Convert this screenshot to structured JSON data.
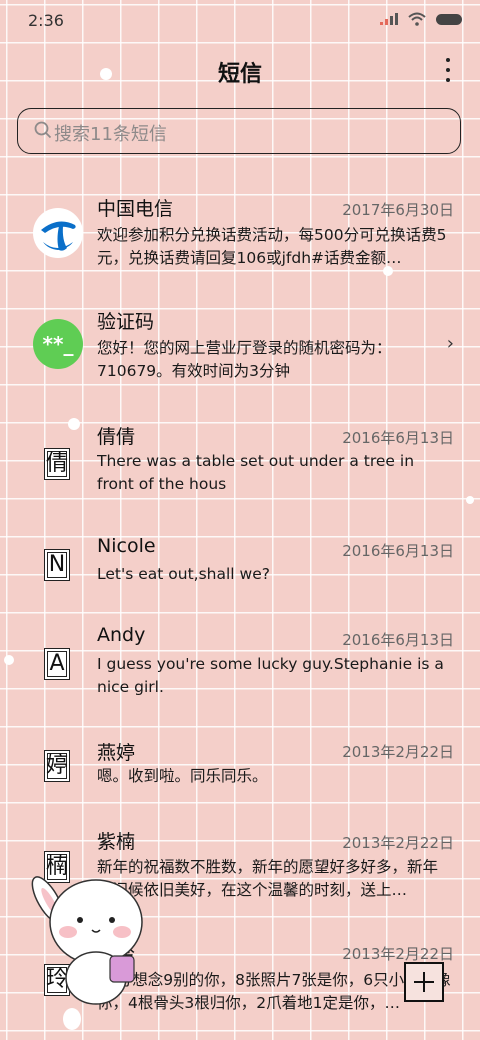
{
  "status_bar": {
    "time": "2:36"
  },
  "header": {
    "title": "短信"
  },
  "search": {
    "placeholder": "搜索11条短信"
  },
  "messages": [
    {
      "name": "中国电信",
      "date": "2017年6月30日",
      "preview": "欢迎参加积分兑换话费活动，每500分可兑换话费5元，兑换话费请回复106或jfdh#话费金额…",
      "avatar": "china-telecom-logo"
    },
    {
      "name": "验证码",
      "date": "",
      "preview": "您好！您的网上营业厅登录的随机密码为：710679。有效时间为3分钟",
      "avatar_text": "**_"
    },
    {
      "name": "倩倩",
      "date": "2016年6月13日",
      "preview": "There was a table set out under a tree in front of the hous",
      "avatar_text": "倩"
    },
    {
      "name": "Nicole",
      "date": "2016年6月13日",
      "preview": "Let's eat out,shall we?",
      "avatar_text": "N"
    },
    {
      "name": "Andy",
      "date": "2016年6月13日",
      "preview": "I guess you're some lucky guy.Stephanie is a nice girl.",
      "avatar_text": "A"
    },
    {
      "name": "燕婷",
      "date": "2013年2月22日",
      "preview": "嗯。收到啦。同乐同乐。",
      "avatar_text": "婷"
    },
    {
      "name": "紫楠",
      "date": "2013年2月22日",
      "preview": "新年的祝福数不胜数，新年的愿望好多好多，新年的问候依旧美好，在这个温馨的时刻，送上…",
      "avatar_text": "楠"
    },
    {
      "name": "子玲",
      "date": "2013年2月22日",
      "preview": "10分想念9别的你，8张照片7张是你，6只小猫只像你，4根骨头3根归你，2爪着地1定是你，…",
      "avatar_text": "玲"
    }
  ],
  "colors": {
    "background": "#f4cfc9",
    "grid": "#ffffff",
    "telecom_blue": "#0a6fc9",
    "code_green": "#5fcd54"
  }
}
